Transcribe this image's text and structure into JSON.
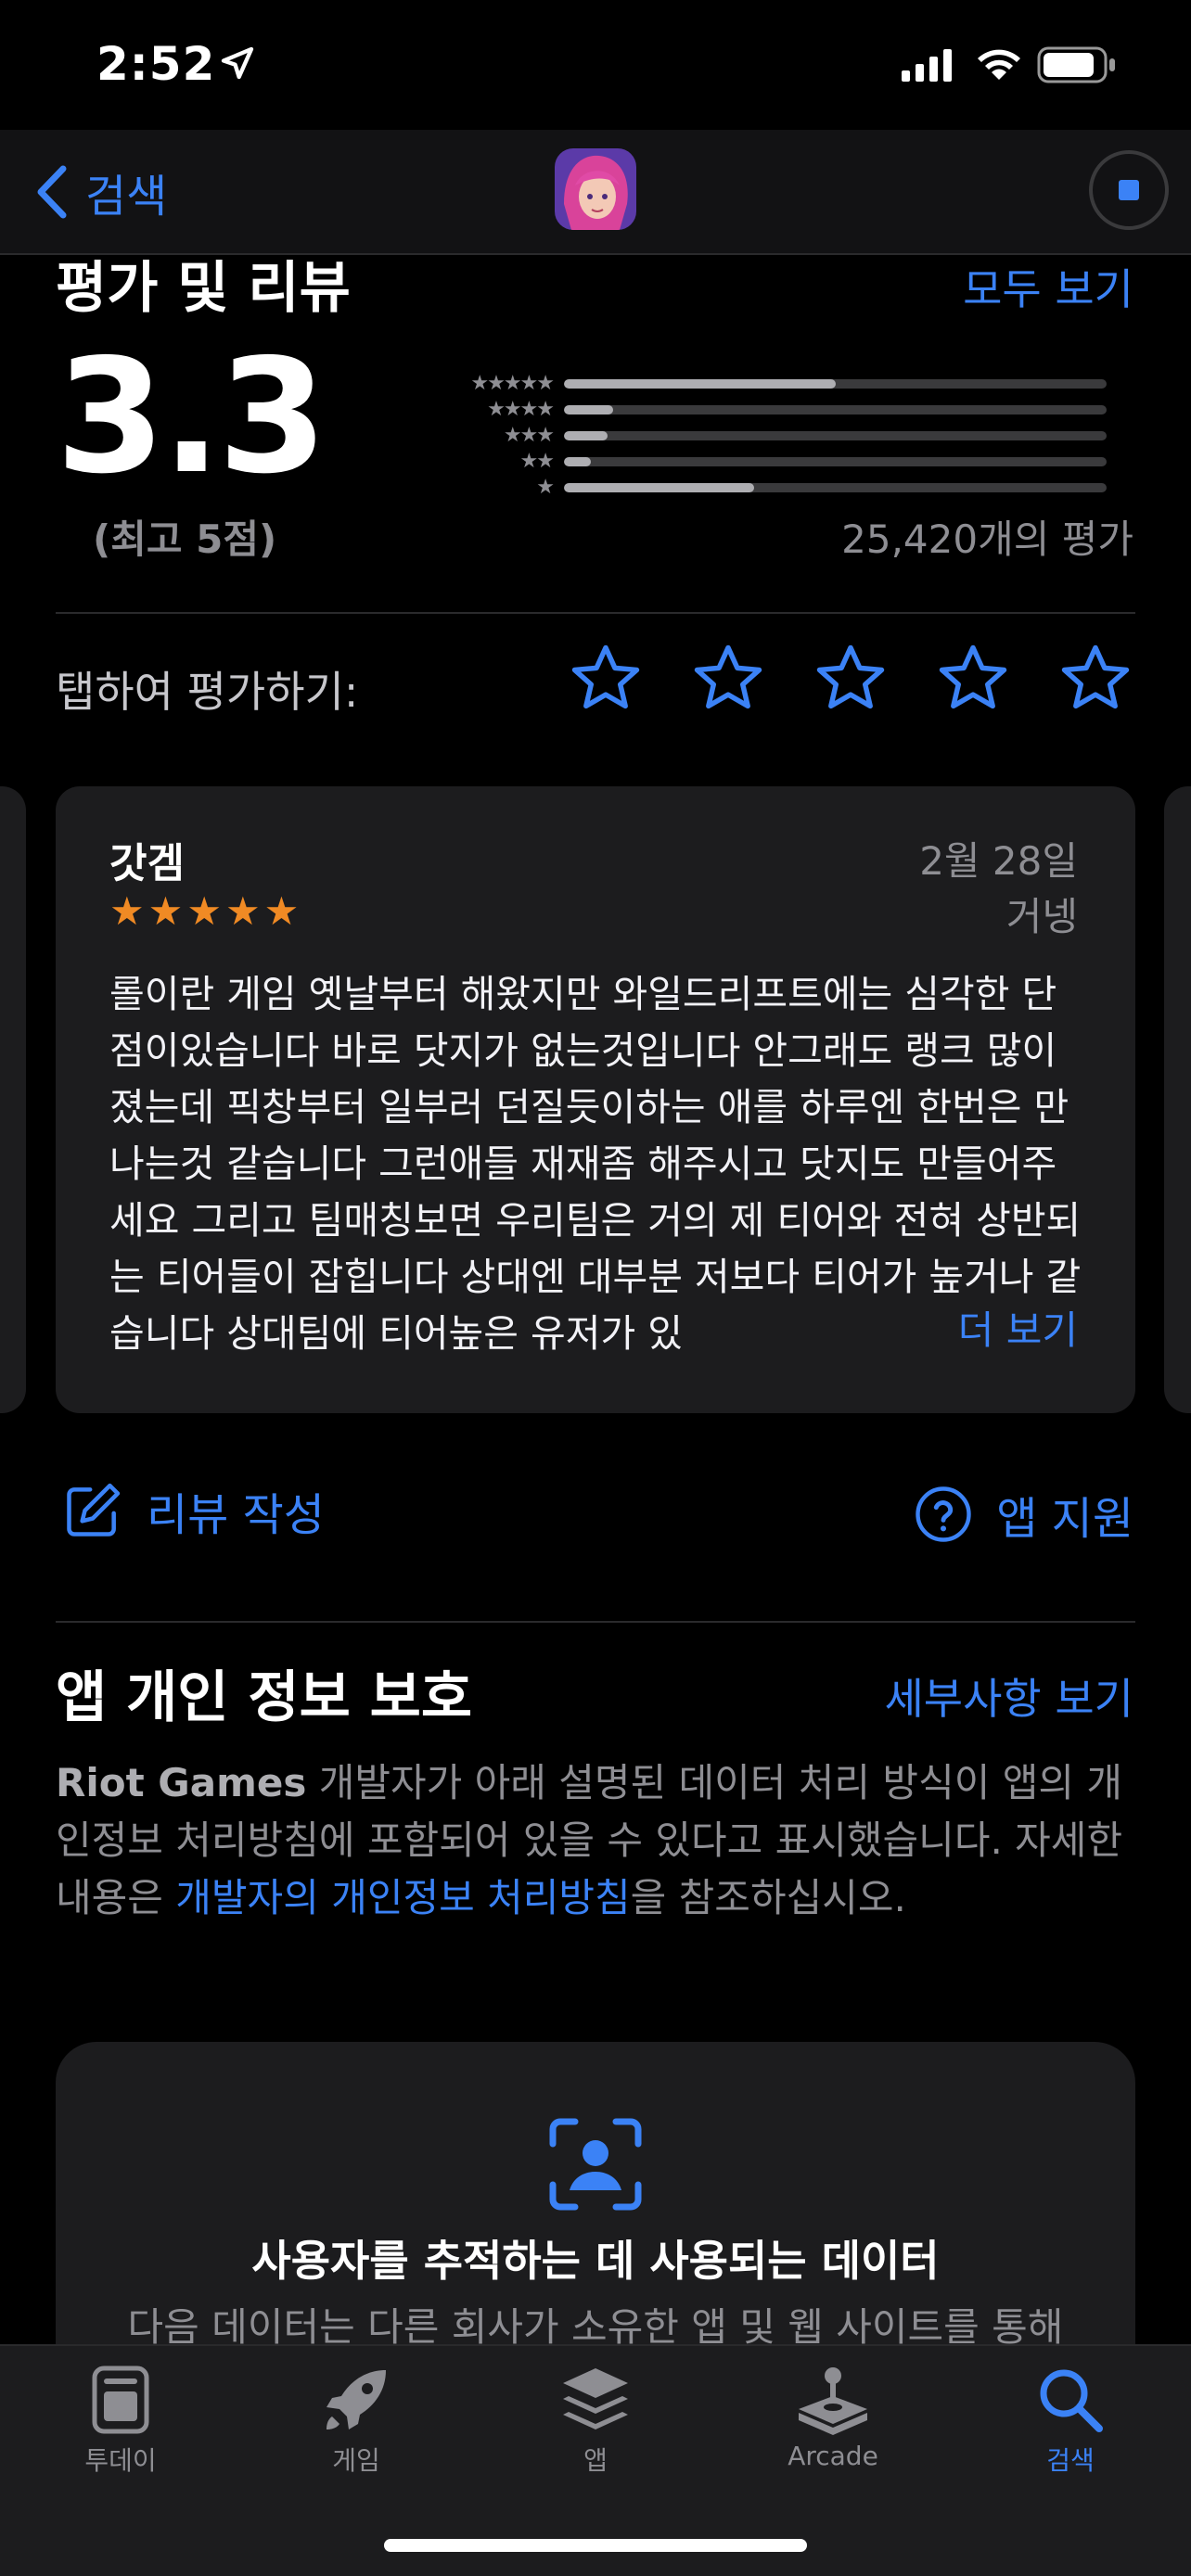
{
  "status": {
    "time": "2:52"
  },
  "nav": {
    "back_label": "검색"
  },
  "ratings": {
    "section_title": "평가 및 리뷰",
    "see_all": "모두 보기",
    "score": "3.3",
    "score_sub": "(최고 5점)",
    "count_label": "25,420개의 평가",
    "distribution": [
      {
        "stars": "★★★★★",
        "fraction": 0.5
      },
      {
        "stars": "★★★★",
        "fraction": 0.09
      },
      {
        "stars": "★★★",
        "fraction": 0.08
      },
      {
        "stars": "★★",
        "fraction": 0.05
      },
      {
        "stars": "★",
        "fraction": 0.35
      }
    ]
  },
  "tap_to_rate": {
    "label": "탭하여 평가하기:",
    "stars": 5
  },
  "review": {
    "title": "갓겜",
    "date": "2월 28일",
    "author": "거넹",
    "rating": 5,
    "body": "롤이란 게임 옛날부터 해왔지만 와일드리프트에는 심각한 단점이있습니다 바로 닷지가 없는것입니다 안그래도 랭크 많이 졌는데 픽창부터 일부러 던질듯이하는 애를 하루엔 한번은 만나는것 같습니다 그런애들 재재좀 해주시고 닷지도 만들어주세요 그리고 팀매칭보면 우리팀은 거의 제 티어와 전혀 상반되는 티어들이 잡힙니다 상대엔 대부분 저보다 티어가 높거나 같습니다 상대팀에 티어높은 유저가 있",
    "more": "더 보기"
  },
  "actions": {
    "write_review": "리뷰 작성",
    "app_support": "앱 지원"
  },
  "privacy": {
    "title": "앱 개인 정보 보호",
    "details_link": "세부사항 보기",
    "developer": "Riot Games",
    "text_part1": " 개발자가 아래 설명된 데이터 처리 방식이 앱의 개인정보 처리방침에 포함되어 있을 수 있다고 표시했습니다. 자세한 내용은 ",
    "policy_link": "개발자의 개인정보 처리방침",
    "text_part2": "을 참조하십시오.",
    "card_title": "사용자를 추적하는 데 사용되는 데이터",
    "card_text": "다음 데이터는 다른 회사가 소유한 앱 및 웹 사이트를 통해"
  },
  "tabs": [
    {
      "label": "투데이",
      "icon": "today-icon"
    },
    {
      "label": "게임",
      "icon": "rocket-icon"
    },
    {
      "label": "앱",
      "icon": "layers-icon"
    },
    {
      "label": "Arcade",
      "icon": "joystick-icon"
    },
    {
      "label": "검색",
      "icon": "search-icon",
      "active": true
    }
  ],
  "colors": {
    "accent": "#3b82f6",
    "star_orange": "#f08a24",
    "card_bg": "#1c1c1e"
  }
}
